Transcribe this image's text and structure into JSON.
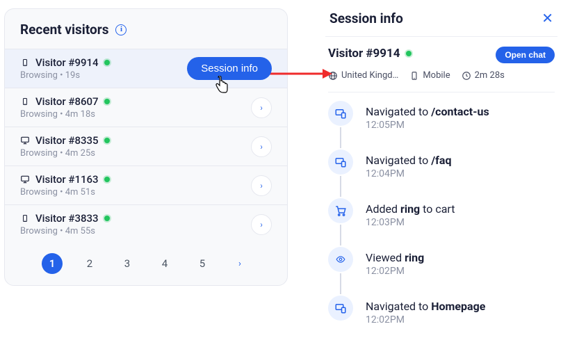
{
  "left": {
    "title": "Recent visitors",
    "session_info_label": "Session info",
    "visitors": [
      {
        "device": "mobile",
        "name": "Visitor #9914",
        "status": "Browsing",
        "duration": "19s",
        "active": true
      },
      {
        "device": "mobile",
        "name": "Visitor #8607",
        "status": "Browsing",
        "duration": "4m 18s",
        "active": false
      },
      {
        "device": "desktop",
        "name": "Visitor #8335",
        "status": "Browsing",
        "duration": "4m 25s",
        "active": false
      },
      {
        "device": "desktop",
        "name": "Visitor #1163",
        "status": "Browsing",
        "duration": "4m 51s",
        "active": false
      },
      {
        "device": "mobile",
        "name": "Visitor #3833",
        "status": "Browsing",
        "duration": "4m 55s",
        "active": false
      }
    ],
    "pages": [
      "1",
      "2",
      "3",
      "4",
      "5"
    ]
  },
  "right": {
    "header": "Session info",
    "visitor_name": "Visitor #9914",
    "open_chat_label": "Open chat",
    "meta": {
      "location": "United Kingd…",
      "device": "Mobile",
      "duration": "2m 28s"
    },
    "timeline": [
      {
        "icon": "nav",
        "prefix": "Navigated to ",
        "bold": "/contact-us",
        "suffix": "",
        "time": "12:05PM"
      },
      {
        "icon": "nav",
        "prefix": "Navigated to ",
        "bold": "/faq",
        "suffix": "",
        "time": "12:04PM"
      },
      {
        "icon": "cart",
        "prefix": "Added ",
        "bold": "ring",
        "suffix": " to cart",
        "time": "12:03PM"
      },
      {
        "icon": "view",
        "prefix": "Viewed ",
        "bold": "ring",
        "suffix": "",
        "time": "12:02PM"
      },
      {
        "icon": "nav",
        "prefix": "Navigated to ",
        "bold": "Homepage",
        "suffix": "",
        "time": "12:02PM"
      }
    ]
  }
}
